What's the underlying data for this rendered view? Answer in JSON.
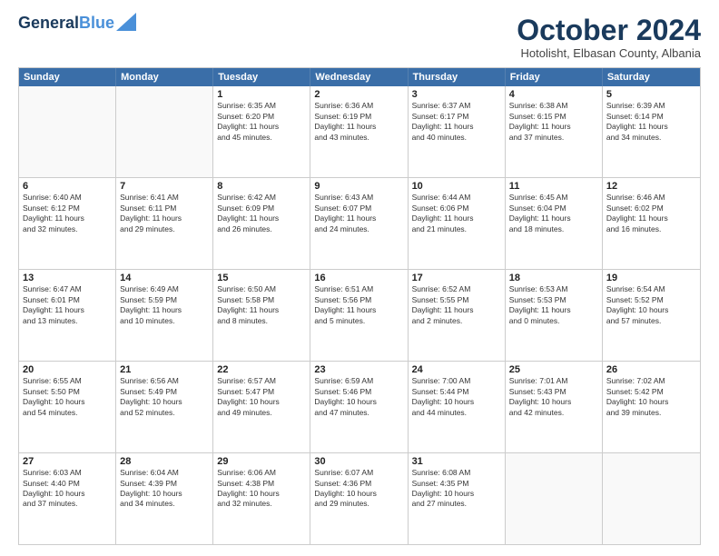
{
  "logo": {
    "line1": "General",
    "line2": "Blue"
  },
  "title": "October 2024",
  "subtitle": "Hotolisht, Elbasan County, Albania",
  "header_days": [
    "Sunday",
    "Monday",
    "Tuesday",
    "Wednesday",
    "Thursday",
    "Friday",
    "Saturday"
  ],
  "weeks": [
    [
      {
        "day": "",
        "lines": []
      },
      {
        "day": "",
        "lines": []
      },
      {
        "day": "1",
        "lines": [
          "Sunrise: 6:35 AM",
          "Sunset: 6:20 PM",
          "Daylight: 11 hours",
          "and 45 minutes."
        ]
      },
      {
        "day": "2",
        "lines": [
          "Sunrise: 6:36 AM",
          "Sunset: 6:19 PM",
          "Daylight: 11 hours",
          "and 43 minutes."
        ]
      },
      {
        "day": "3",
        "lines": [
          "Sunrise: 6:37 AM",
          "Sunset: 6:17 PM",
          "Daylight: 11 hours",
          "and 40 minutes."
        ]
      },
      {
        "day": "4",
        "lines": [
          "Sunrise: 6:38 AM",
          "Sunset: 6:15 PM",
          "Daylight: 11 hours",
          "and 37 minutes."
        ]
      },
      {
        "day": "5",
        "lines": [
          "Sunrise: 6:39 AM",
          "Sunset: 6:14 PM",
          "Daylight: 11 hours",
          "and 34 minutes."
        ]
      }
    ],
    [
      {
        "day": "6",
        "lines": [
          "Sunrise: 6:40 AM",
          "Sunset: 6:12 PM",
          "Daylight: 11 hours",
          "and 32 minutes."
        ]
      },
      {
        "day": "7",
        "lines": [
          "Sunrise: 6:41 AM",
          "Sunset: 6:11 PM",
          "Daylight: 11 hours",
          "and 29 minutes."
        ]
      },
      {
        "day": "8",
        "lines": [
          "Sunrise: 6:42 AM",
          "Sunset: 6:09 PM",
          "Daylight: 11 hours",
          "and 26 minutes."
        ]
      },
      {
        "day": "9",
        "lines": [
          "Sunrise: 6:43 AM",
          "Sunset: 6:07 PM",
          "Daylight: 11 hours",
          "and 24 minutes."
        ]
      },
      {
        "day": "10",
        "lines": [
          "Sunrise: 6:44 AM",
          "Sunset: 6:06 PM",
          "Daylight: 11 hours",
          "and 21 minutes."
        ]
      },
      {
        "day": "11",
        "lines": [
          "Sunrise: 6:45 AM",
          "Sunset: 6:04 PM",
          "Daylight: 11 hours",
          "and 18 minutes."
        ]
      },
      {
        "day": "12",
        "lines": [
          "Sunrise: 6:46 AM",
          "Sunset: 6:02 PM",
          "Daylight: 11 hours",
          "and 16 minutes."
        ]
      }
    ],
    [
      {
        "day": "13",
        "lines": [
          "Sunrise: 6:47 AM",
          "Sunset: 6:01 PM",
          "Daylight: 11 hours",
          "and 13 minutes."
        ]
      },
      {
        "day": "14",
        "lines": [
          "Sunrise: 6:49 AM",
          "Sunset: 5:59 PM",
          "Daylight: 11 hours",
          "and 10 minutes."
        ]
      },
      {
        "day": "15",
        "lines": [
          "Sunrise: 6:50 AM",
          "Sunset: 5:58 PM",
          "Daylight: 11 hours",
          "and 8 minutes."
        ]
      },
      {
        "day": "16",
        "lines": [
          "Sunrise: 6:51 AM",
          "Sunset: 5:56 PM",
          "Daylight: 11 hours",
          "and 5 minutes."
        ]
      },
      {
        "day": "17",
        "lines": [
          "Sunrise: 6:52 AM",
          "Sunset: 5:55 PM",
          "Daylight: 11 hours",
          "and 2 minutes."
        ]
      },
      {
        "day": "18",
        "lines": [
          "Sunrise: 6:53 AM",
          "Sunset: 5:53 PM",
          "Daylight: 11 hours",
          "and 0 minutes."
        ]
      },
      {
        "day": "19",
        "lines": [
          "Sunrise: 6:54 AM",
          "Sunset: 5:52 PM",
          "Daylight: 10 hours",
          "and 57 minutes."
        ]
      }
    ],
    [
      {
        "day": "20",
        "lines": [
          "Sunrise: 6:55 AM",
          "Sunset: 5:50 PM",
          "Daylight: 10 hours",
          "and 54 minutes."
        ]
      },
      {
        "day": "21",
        "lines": [
          "Sunrise: 6:56 AM",
          "Sunset: 5:49 PM",
          "Daylight: 10 hours",
          "and 52 minutes."
        ]
      },
      {
        "day": "22",
        "lines": [
          "Sunrise: 6:57 AM",
          "Sunset: 5:47 PM",
          "Daylight: 10 hours",
          "and 49 minutes."
        ]
      },
      {
        "day": "23",
        "lines": [
          "Sunrise: 6:59 AM",
          "Sunset: 5:46 PM",
          "Daylight: 10 hours",
          "and 47 minutes."
        ]
      },
      {
        "day": "24",
        "lines": [
          "Sunrise: 7:00 AM",
          "Sunset: 5:44 PM",
          "Daylight: 10 hours",
          "and 44 minutes."
        ]
      },
      {
        "day": "25",
        "lines": [
          "Sunrise: 7:01 AM",
          "Sunset: 5:43 PM",
          "Daylight: 10 hours",
          "and 42 minutes."
        ]
      },
      {
        "day": "26",
        "lines": [
          "Sunrise: 7:02 AM",
          "Sunset: 5:42 PM",
          "Daylight: 10 hours",
          "and 39 minutes."
        ]
      }
    ],
    [
      {
        "day": "27",
        "lines": [
          "Sunrise: 6:03 AM",
          "Sunset: 4:40 PM",
          "Daylight: 10 hours",
          "and 37 minutes."
        ]
      },
      {
        "day": "28",
        "lines": [
          "Sunrise: 6:04 AM",
          "Sunset: 4:39 PM",
          "Daylight: 10 hours",
          "and 34 minutes."
        ]
      },
      {
        "day": "29",
        "lines": [
          "Sunrise: 6:06 AM",
          "Sunset: 4:38 PM",
          "Daylight: 10 hours",
          "and 32 minutes."
        ]
      },
      {
        "day": "30",
        "lines": [
          "Sunrise: 6:07 AM",
          "Sunset: 4:36 PM",
          "Daylight: 10 hours",
          "and 29 minutes."
        ]
      },
      {
        "day": "31",
        "lines": [
          "Sunrise: 6:08 AM",
          "Sunset: 4:35 PM",
          "Daylight: 10 hours",
          "and 27 minutes."
        ]
      },
      {
        "day": "",
        "lines": []
      },
      {
        "day": "",
        "lines": []
      }
    ]
  ]
}
